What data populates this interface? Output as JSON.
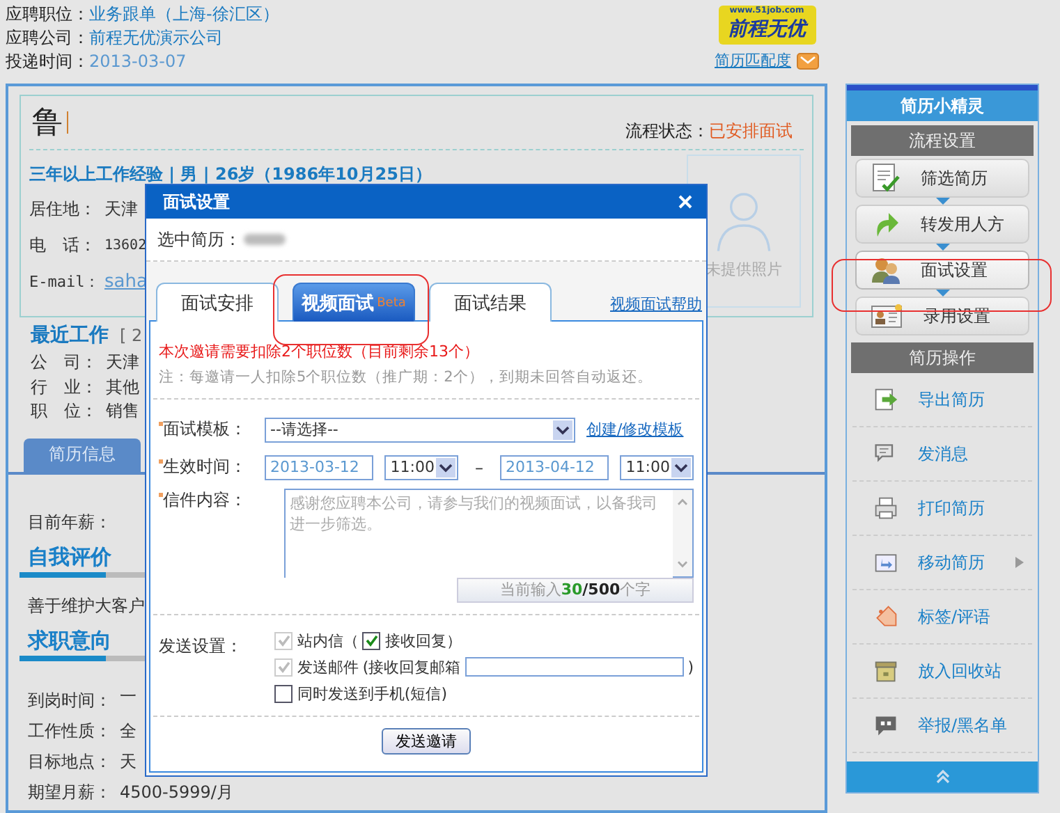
{
  "job_info": [
    {
      "label": "应聘职位：",
      "value": "业务跟单（上海-徐汇区）"
    },
    {
      "label": "应聘公司：",
      "value": "前程无优演示公司"
    },
    {
      "label": "投递时间：",
      "value": "2013-03-07"
    }
  ],
  "logo": {
    "site": "www.51job.com",
    "brand": "前程无优"
  },
  "match_link": "简历匹配度",
  "resume": {
    "name": "鲁",
    "status_label": "流程状态：",
    "status": "已安排面试",
    "summary": "三年以上工作经验 | 男 | 26岁（1986年10月25日）",
    "contact": [
      {
        "label": "居住地：",
        "value": "天津",
        "kind": "text"
      },
      {
        "label": "电　话：",
        "value": "13602",
        "kind": "mono"
      },
      {
        "label": "E-mail：",
        "value": "saha",
        "kind": "link"
      }
    ],
    "photo_caption": "未提供照片",
    "recent_work": {
      "title": "最近工作",
      "extra": "[ 2",
      "rows": [
        {
          "label": "公　司：",
          "value": "天津"
        },
        {
          "label": "行　业：",
          "value": "其他"
        },
        {
          "label": "职　位：",
          "value": "销售"
        }
      ]
    },
    "tabs": [
      {
        "label": "简历信息",
        "selected": true
      }
    ],
    "salary_label": "目前年薪：",
    "self_review": {
      "title": "自我评价",
      "text": "善于维护大客户"
    },
    "intent": {
      "title": "求职意向",
      "rows": [
        {
          "label": "到岗时间：",
          "value": "一"
        },
        {
          "label": "工作性质：",
          "value": "全"
        },
        {
          "label": "目标地点：",
          "value": "天"
        },
        {
          "label": "期望月薪：",
          "value": "4500-5999/月"
        }
      ]
    }
  },
  "sidebar": {
    "title": "简历小精灵",
    "groups": [
      {
        "title": "流程设置",
        "kind": "steps",
        "items": [
          {
            "label": "筛选简历",
            "selected": false
          },
          {
            "label": "转发用人方",
            "selected": false
          },
          {
            "label": "面试设置",
            "selected": true
          },
          {
            "label": "录用设置",
            "selected": false
          }
        ]
      },
      {
        "title": "简历操作",
        "kind": "actions",
        "items": [
          {
            "label": "导出简历",
            "has_submenu": false
          },
          {
            "label": "发消息",
            "has_submenu": false
          },
          {
            "label": "打印简历",
            "has_submenu": false
          },
          {
            "label": "移动简历",
            "has_submenu": true
          },
          {
            "label": "标签/评语",
            "has_submenu": false
          },
          {
            "label": "放入回收站",
            "has_submenu": false
          },
          {
            "label": "举报/黑名单",
            "has_submenu": false
          }
        ]
      }
    ]
  },
  "dialog": {
    "title": "面试设置",
    "selected_label": "选中简历：",
    "tabs": [
      {
        "label": "面试安排",
        "selected": false
      },
      {
        "label": "视频面试",
        "badge": "Beta",
        "selected": true
      },
      {
        "label": "面试结果",
        "selected": false
      }
    ],
    "help_link": "视频面试帮助",
    "notice": "本次邀请需要扣除2个职位数（目前剩余13个）",
    "note": "注：每邀请一人扣除5个职位数（推广期：2个），到期未回答自动返还。",
    "template": {
      "label": "面试模板：",
      "value": "--请选择--",
      "link": "创建/修改模板"
    },
    "period": {
      "label": "生效时间：",
      "start_date": "2013-03-12",
      "start_time": "11:00",
      "separator": "–",
      "end_date": "2013-04-12",
      "end_time": "11:00"
    },
    "letter": {
      "label": "信件内容：",
      "placeholder": "感谢您应聘本公司，请参与我们的视频面试，以备我司进一步筛选。"
    },
    "counter": {
      "prefix": "当前输入",
      "count": "30",
      "total": "/500",
      "suffix": "个字"
    },
    "send_settings": {
      "label": "发送设置：",
      "rows": [
        {
          "items": [
            {
              "kind": "checkbox",
              "checked": true,
              "disabled": true
            },
            {
              "kind": "text",
              "text": "站内信（"
            },
            {
              "kind": "checkbox",
              "checked": true,
              "disabled": false
            },
            {
              "kind": "text",
              "text": "接收回复）"
            }
          ]
        },
        {
          "items": [
            {
              "kind": "checkbox",
              "checked": true,
              "disabled": true
            },
            {
              "kind": "text",
              "text": "发送邮件"
            },
            {
              "kind": "text",
              "text": "(接收回复邮箱"
            },
            {
              "kind": "input"
            },
            {
              "kind": "text",
              "text": ")"
            }
          ]
        },
        {
          "items": [
            {
              "kind": "checkbox",
              "checked": false,
              "disabled": false
            },
            {
              "kind": "text",
              "text": "同时发送到手机(短信)"
            }
          ]
        }
      ]
    },
    "submit": "发送邀请"
  }
}
